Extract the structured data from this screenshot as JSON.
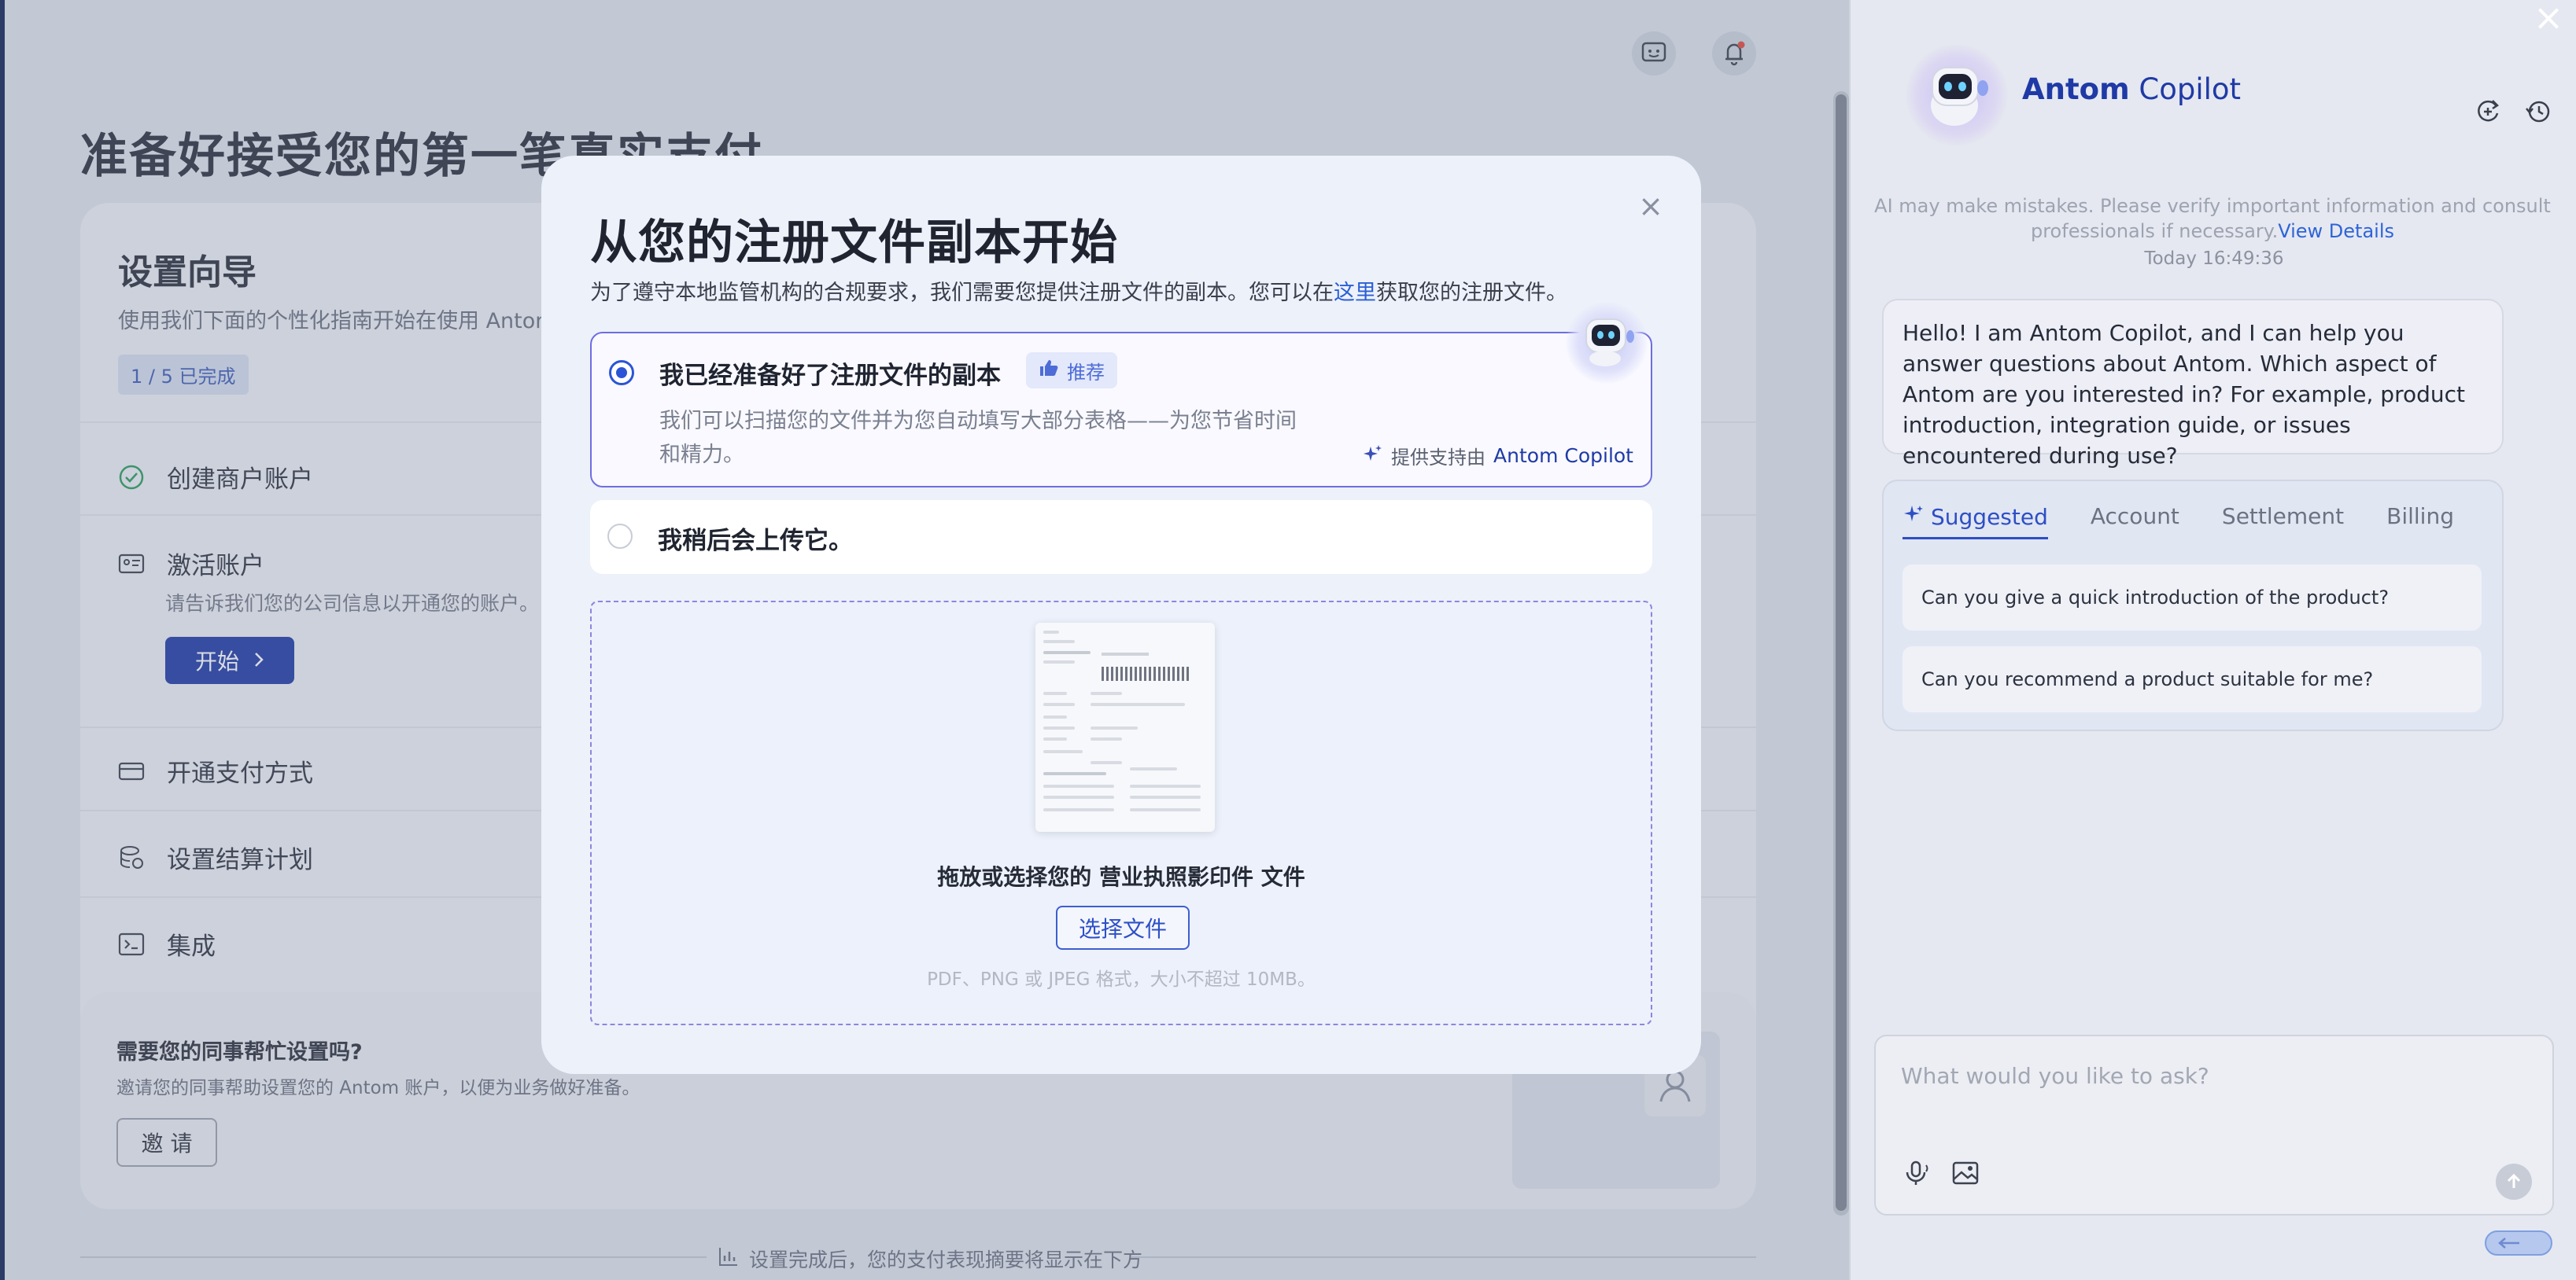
{
  "page": {
    "title": "准备好接受您的第一笔真实支付",
    "wizard": {
      "title": "设置向导",
      "subtitle": "使用我们下面的个性化指南开始在使用 Antom",
      "progress": "1 / 5 已完成",
      "steps": [
        {
          "label": "创建商户账户",
          "icon": "check-circle-icon",
          "done": true
        },
        {
          "label": "激活账户",
          "icon": "id-card-icon",
          "desc": "请告诉我们您的公司信息以开通您的账户。",
          "button": "开始"
        },
        {
          "label": "开通支付方式",
          "icon": "card-icon"
        },
        {
          "label": "设置结算计划",
          "icon": "coins-icon"
        },
        {
          "label": "集成",
          "icon": "terminal-icon"
        }
      ]
    },
    "help": {
      "title": "需要您的同事帮忙设置吗?",
      "subtitle": "邀请您的同事帮助设置您的 Antom 账户，以便为业务做好准备。",
      "button": "邀 请"
    },
    "footer_note": "设置完成后，您的支付表现摘要将显示在下方"
  },
  "modal": {
    "title": "从您的注册文件副本开始",
    "subtitle_pre": "为了遵守本地监管机构的合规要求，我们需要您提供注册文件的副本。您可以在",
    "subtitle_link": "这里",
    "subtitle_post": "获取您的注册文件。",
    "option_ready": {
      "label": "我已经准备好了注册文件的副本",
      "badge": "推荐",
      "desc": "我们可以扫描您的文件并为您自动填写大部分表格——为您节省时间和精力。",
      "powered_by": "提供支持由",
      "powered_brand": "Antom Copilot",
      "selected": true
    },
    "option_later": {
      "label": "我稍后会上传它。",
      "selected": false
    },
    "dropzone": {
      "text": "拖放或选择您的 营业执照影印件 文件",
      "button": "选择文件",
      "hint": "PDF、PNG 或 JPEG 格式，大小不超过 10MB。"
    }
  },
  "copilot": {
    "name_bold": "Antom",
    "name_rest": " Copilot",
    "disclaimer": "AI may make mistakes. Please verify important information and consult professionals if necessary.",
    "disclaimer_link": "View Details",
    "timestamp": "Today 16:49:36",
    "greeting": "Hello! I am Antom Copilot, and I can help you answer questions about Antom. Which aspect of Antom are you interested in? For example, product introduction, integration guide, or issues encountered during use?",
    "tabs": [
      "Suggested",
      "Account",
      "Settlement",
      "Billing"
    ],
    "active_tab": "Suggested",
    "suggestions": [
      "Can you give a quick introduction of the product?",
      "Can you recommend a product suitable for me?"
    ],
    "input_placeholder": "What would you like to ask?"
  },
  "colors": {
    "accent": "#2a55d6",
    "brand_dark": "#1f3aa6",
    "option_border": "#6f6de0"
  }
}
